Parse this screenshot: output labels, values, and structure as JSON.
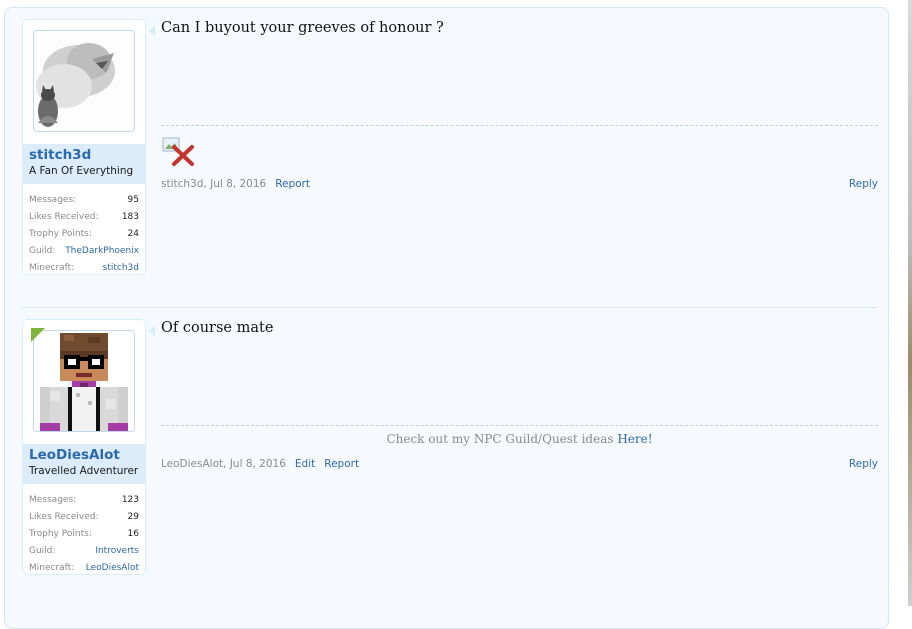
{
  "posts": [
    {
      "username": "stitch3d",
      "user_title": "A Fan Of Everything",
      "avatar_icon": "lion-and-cat-avatar",
      "online": false,
      "stats": [
        {
          "label": "Messages:",
          "value": "95"
        },
        {
          "label": "Likes Received:",
          "value": "183"
        },
        {
          "label": "Trophy Points:",
          "value": "24"
        },
        {
          "label": "Guild:",
          "value": "TheDarkPhoenix"
        },
        {
          "label": "Minecraft:",
          "value": "stitch3d"
        }
      ],
      "message": "Can I buyout your greeves of honour ?",
      "attachment_icon": "broken-image-icon",
      "meta_author": "stitch3d",
      "meta_date": "Jul 8, 2016",
      "actions": [
        "Report"
      ],
      "reply_label": "Reply"
    },
    {
      "username": "LeoDiesAlot",
      "user_title": "Travelled Adventurer",
      "avatar_icon": "minecraft-skin-avatar",
      "online": true,
      "stats": [
        {
          "label": "Messages:",
          "value": "123"
        },
        {
          "label": "Likes Received:",
          "value": "29"
        },
        {
          "label": "Trophy Points:",
          "value": "16"
        },
        {
          "label": "Guild:",
          "value": "Introverts"
        },
        {
          "label": "Minecraft:",
          "value": "LeoDiesAlot"
        }
      ],
      "message": "Of course mate",
      "signature_text": "Check out my NPC Guild/Quest ideas",
      "signature_link": "Here!",
      "meta_author": "LeoDiesAlot",
      "meta_date": "Jul 8, 2016",
      "actions": [
        "Edit",
        "Report"
      ],
      "reply_label": "Reply"
    }
  ],
  "colors": {
    "link": "#2b69ad",
    "panel_border": "#d7edfc",
    "name_block_bg": "#dcecfa",
    "online_badge": "#7fb33a",
    "page_bg": "#f6f9fe"
  }
}
